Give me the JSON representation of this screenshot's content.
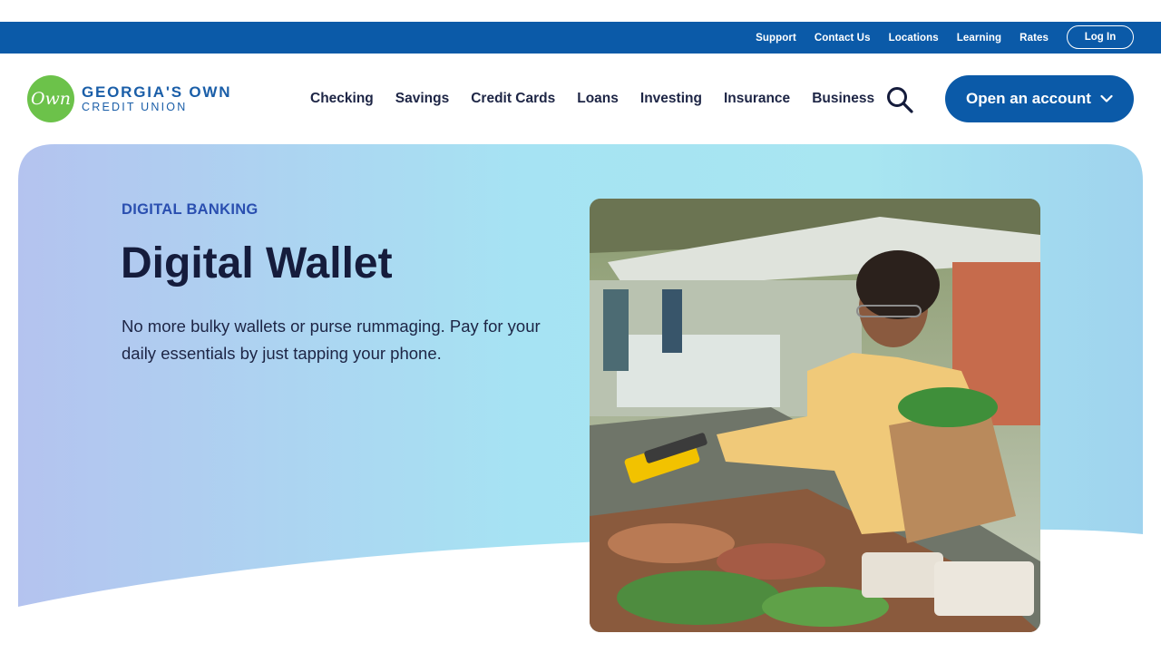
{
  "utility_nav": {
    "links": [
      "Support",
      "Contact Us",
      "Locations",
      "Learning",
      "Rates"
    ],
    "login_label": "Log In"
  },
  "logo": {
    "mark_text": "Own",
    "line1": "GEORGIA'S OWN",
    "line2": "CREDIT UNION"
  },
  "main_nav": {
    "items": [
      "Checking",
      "Savings",
      "Credit Cards",
      "Loans",
      "Investing",
      "Insurance",
      "Business"
    ],
    "search_icon": "search-icon",
    "cta_label": "Open an account",
    "cta_icon": "chevron-down-icon"
  },
  "hero": {
    "eyebrow": "DIGITAL BANKING",
    "title": "Digital Wallet",
    "description": "No more bulky wallets or purse rummaging. Pay for your daily essentials by just tapping your phone."
  },
  "colors": {
    "brand_blue": "#0b5aa8",
    "logo_green": "#6cc24a",
    "heading_navy": "#151c3c",
    "eyebrow_blue": "#2a4fb0"
  }
}
